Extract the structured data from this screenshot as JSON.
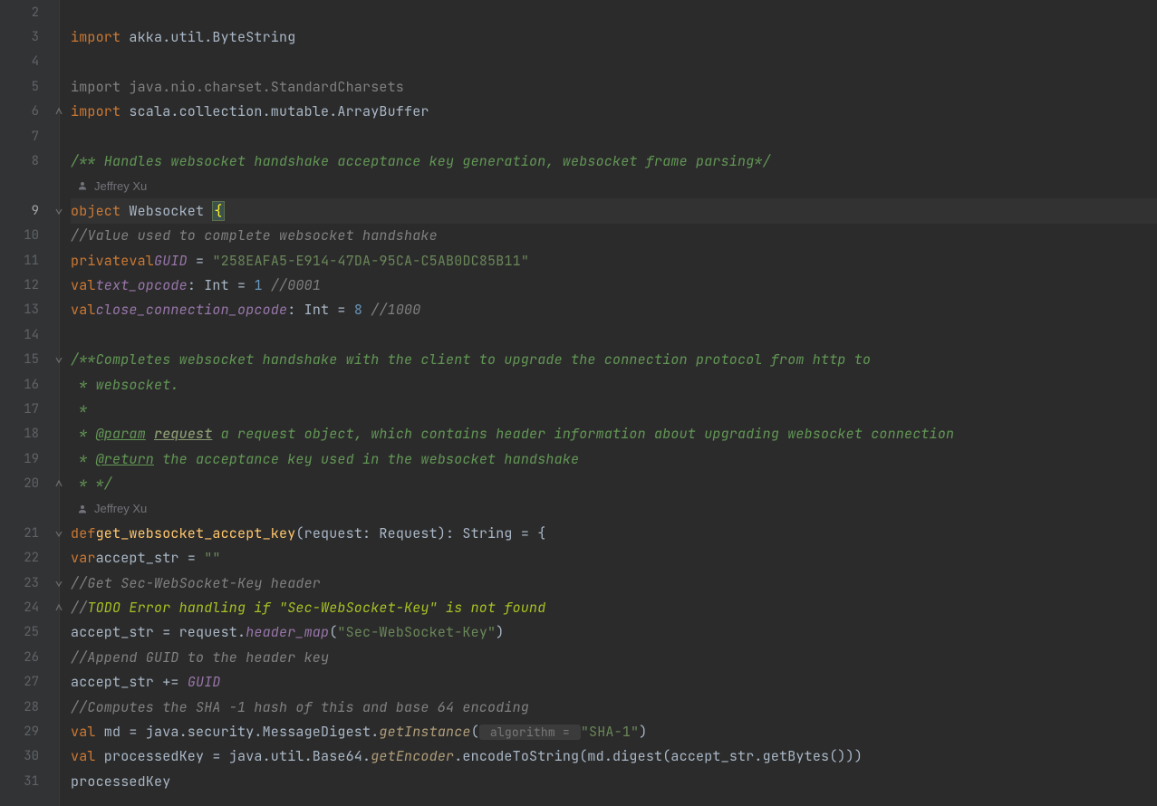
{
  "author": "Jeffrey Xu",
  "gutter": {
    "start": 2,
    "end": 31
  },
  "tokens": {
    "kw_import": "import",
    "kw_object": "object",
    "kw_private": "private",
    "kw_val": "val",
    "kw_var": "var",
    "kw_def": "def"
  },
  "code": {
    "l2": "",
    "l3_rest": " akka.util.ByteString",
    "l4": "",
    "l5_rest": " java.nio.charset.StandardCharsets",
    "l6_rest": " scala.collection.mutable.ArrayBuffer",
    "l7": "",
    "l8_doc": "/** Handles websocket handshake acceptance key generation, websocket frame parsing*/",
    "l9_obj": " Websocket ",
    "l9_brace": "{",
    "l10_cmt": "//Value used to complete websocket handshake",
    "l11_field": "GUID",
    "l11_eq": " = ",
    "l11_str": "\"258EAFA5-E914-47DA-95CA-C5AB0DC85B11\"",
    "l12_field": "text_opcode",
    "l12_colon": ": ",
    "l12_type": "Int",
    "l12_eq": " = ",
    "l12_num": "1",
    "l12_cmt": " //0001",
    "l13_field": "close_connection_opcode",
    "l13_colon": ": ",
    "l13_type": "Int",
    "l13_eq": " = ",
    "l13_num": "8",
    "l13_cmt": " //1000",
    "l14": "",
    "l15_doc": "/**Completes websocket handshake with the client to upgrade the connection protocol from http to",
    "l16_doc": " * websocket.",
    "l17_doc": " *",
    "l18_pre": " * ",
    "l18_tag": "@param",
    "l18_sp": " ",
    "l18_param": "request",
    "l18_rest": " a request object, which contains header information about upgrading websocket connection",
    "l19_pre": " * ",
    "l19_tag": "@return",
    "l19_rest": " the acceptance key used in the websocket handshake",
    "l20_doc": " * */",
    "l21_name": "get_websocket_accept_key",
    "l21_sig": "(request: Request): String = {",
    "l22_name": "accept_str",
    "l22_eq": " = ",
    "l22_str": "\"\"",
    "l23_cmt": "//Get Sec-WebSocket-Key header",
    "l24_pre": "//",
    "l24_todo": "TODO Error handling if \"Sec-WebSocket-Key\" is not found",
    "l25_a": "accept_str = request.",
    "l25_field": "header_map",
    "l25_lp": "(",
    "l25_str": "\"Sec-WebSocket-Key\"",
    "l25_rp": ")",
    "l26_cmt": "//Append GUID to the header key",
    "l27_a": "accept_str += ",
    "l27_field": "GUID",
    "l28_cmt": "//Computes the SHA -1 hash of this and base 64 encoding",
    "l29_a": " md = java.security.MessageDigest.",
    "l29_call": "getInstance",
    "l29_lp": "(",
    "l29_hint": " algorithm = ",
    "l29_str": "\"SHA-1\"",
    "l29_rp": ")",
    "l30_a": " processedKey = java.util.Base64.",
    "l30_call": "getEncoder",
    "l30_b": ".encodeToString(md.digest(accept_str.getBytes()))",
    "l31": "processedKey"
  }
}
